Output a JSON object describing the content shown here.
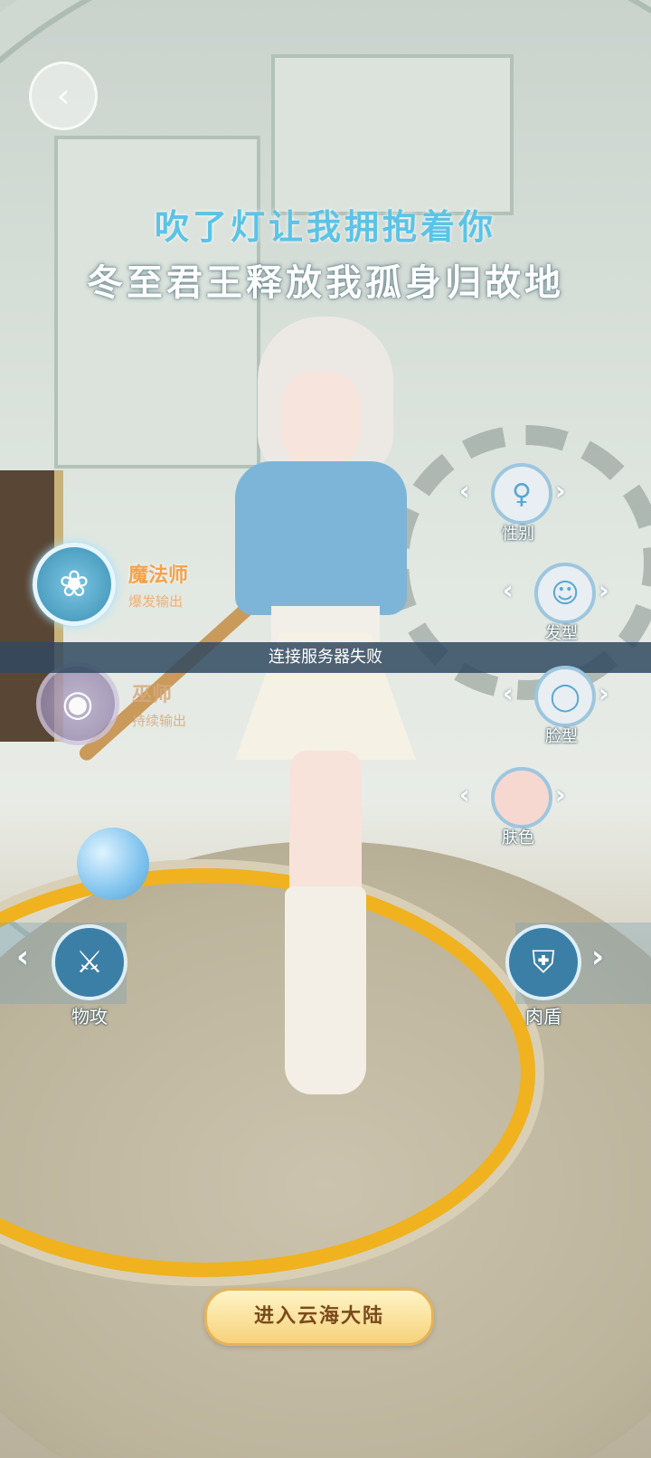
{
  "lyrics": {
    "line1": "吹了灯让我拥抱着你",
    "line2": "冬至君王释放我孤身归故地"
  },
  "back_button": {
    "icon": "back-arrow-icon"
  },
  "classes": [
    {
      "name": "魔法师",
      "subtitle": "爆发输出",
      "icon": "mage-staff-icon",
      "selected": true
    },
    {
      "name": "巫师",
      "subtitle": "持续输出",
      "icon": "eye-sigil-icon",
      "selected": false
    }
  ],
  "toast": "连接服务器失败",
  "customization": [
    {
      "label": "性别",
      "icon": "female-symbol-icon"
    },
    {
      "label": "发型",
      "icon": "hair-icon"
    },
    {
      "label": "脸型",
      "icon": "face-icon"
    },
    {
      "label": "肤色",
      "icon": "skin-color-icon"
    }
  ],
  "roles": {
    "left": {
      "label": "物攻",
      "icon": "slash-attack-icon"
    },
    "right": {
      "label": "肉盾",
      "icon": "shield-icon"
    }
  },
  "enter_button": "进入云海大陆",
  "colors": {
    "lyric_accent": "#5cc3e6",
    "class_selected": "#f3a24a",
    "button_gold": "#f6d27a",
    "toast_bg": "#304960"
  }
}
